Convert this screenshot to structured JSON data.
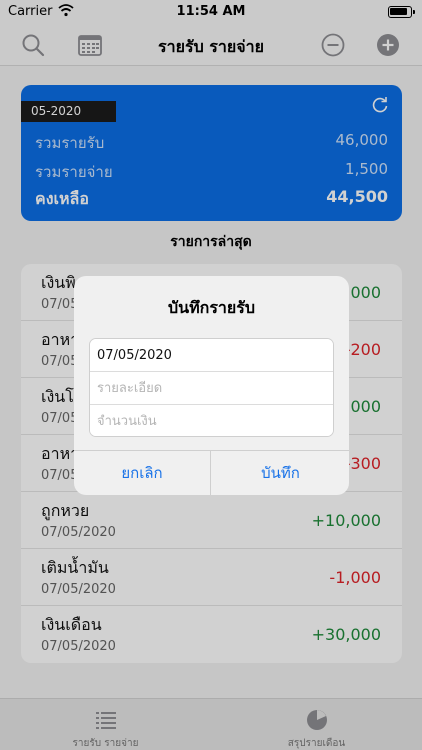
{
  "status_bar": {
    "carrier": "Carrier",
    "time": "11:54 AM"
  },
  "nav": {
    "title": "รายรับ รายจ่าย",
    "icons": [
      "search-icon",
      "calendar-icon",
      "minus-circle-icon",
      "plus-circle-icon"
    ]
  },
  "summary": {
    "month": "05-2020",
    "income_label": "รวมรายรับ",
    "income_value": "46,000",
    "expense_label": "รวมรายจ่าย",
    "expense_value": "1,500",
    "balance_label": "คงเหลือ",
    "balance_value": "44,500",
    "accent": "#0b6ee6"
  },
  "recent": {
    "title": "รายการล่าสุด",
    "items": [
      {
        "name": "เงินพิ",
        "date": "07/05/2020",
        "amount": "+5,000",
        "type": "income"
      },
      {
        "name": "อาหา",
        "date": "07/05/2020",
        "amount": "-200",
        "type": "expense"
      },
      {
        "name": "เงินโ",
        "date": "07/05/2020",
        "amount": "+1,000",
        "type": "income"
      },
      {
        "name": "อาหา",
        "date": "07/05/2020",
        "amount": "-300",
        "type": "expense"
      },
      {
        "name": "ถูกหวย",
        "date": "07/05/2020",
        "amount": "+10,000",
        "type": "income"
      },
      {
        "name": "เติมน้ำมัน",
        "date": "07/05/2020",
        "amount": "-1,000",
        "type": "expense"
      },
      {
        "name": "เงินเดือน",
        "date": "07/05/2020",
        "amount": "+30,000",
        "type": "income"
      }
    ],
    "colors": {
      "income": "#1f8a3b",
      "expense": "#e0242a"
    }
  },
  "dialog": {
    "title": "บันทึกรายรับ",
    "date_value": "07/05/2020",
    "detail_placeholder": "รายละเอียด",
    "amount_placeholder": "จำนวนเงิน",
    "cancel_label": "ยกเลิก",
    "save_label": "บันทึก"
  },
  "tabs": [
    {
      "label": "รายรับ รายจ่าย",
      "icon": "list-icon"
    },
    {
      "label": "สรุปรายเดือน",
      "icon": "pie-chart-icon"
    }
  ]
}
